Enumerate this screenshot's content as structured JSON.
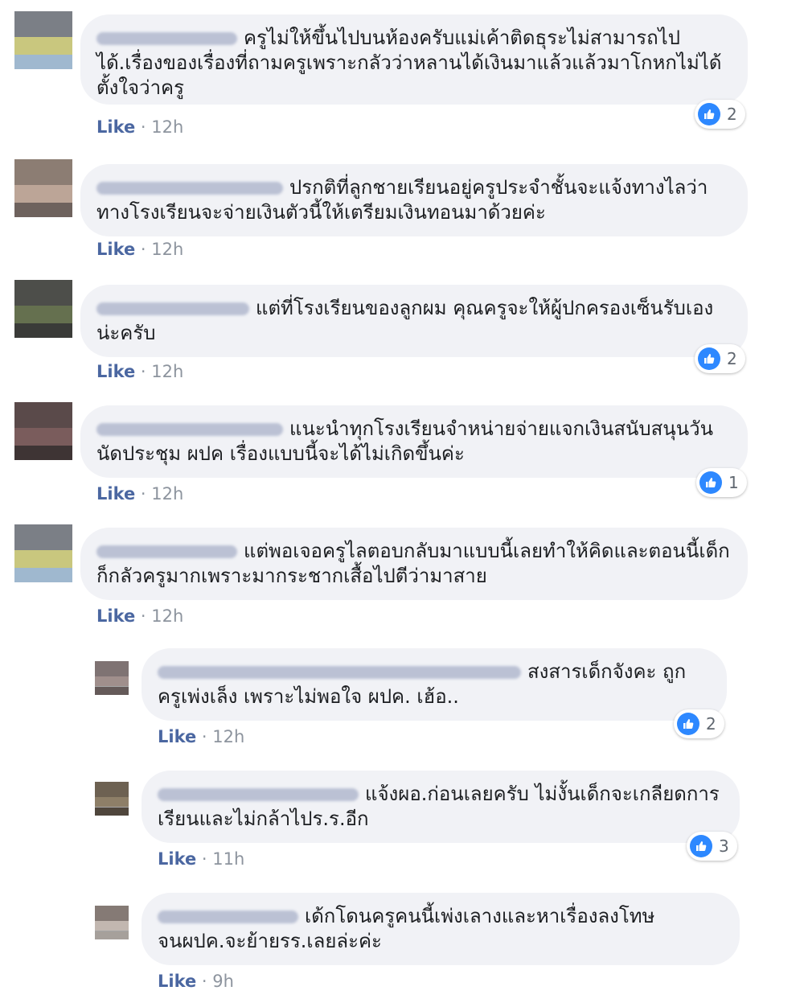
{
  "like_label": "Like",
  "comments": [
    {
      "name_width": 175,
      "text": "ครูไม่ให้ขึ้นไปบนห้องครับแม่เค้าติดธุระไม่สามารถไปได้.เรื่องของเรื่องที่ถามครูเพราะกลัวว่าหลานได้เงินมาแล้วแล้วมาโกหกไม่ได้ตั้งใจว่าครู",
      "time": "12h",
      "reactions": "2",
      "avatar_colors": [
        "#7b7f86",
        "#c9c77e",
        "#9fb8cf"
      ]
    },
    {
      "name_width": 232,
      "text": "ปรกติที่ลูกชายเรียนอยู่ครูประจำชั้นจะแจ้งทางไลว่าทางโรงเรียนจะจ่ายเงินตัวนี้ให้เตรียมเงินทอนมาด้วยค่ะ",
      "time": "12h",
      "reactions": "",
      "avatar_colors": [
        "#8c7d73",
        "#bca597",
        "#6e625d"
      ]
    },
    {
      "name_width": 190,
      "text": "แต่ที่โรงเรียนของลูกผม คุณครูจะให้ผู้ปกครองเซ็นรับเองน่ะครับ",
      "time": "12h",
      "reactions": "2",
      "avatar_colors": [
        "#4d4e4a",
        "#65704f",
        "#3a3b38"
      ]
    },
    {
      "name_width": 232,
      "text": "แนะนำทุกโรงเรียนจำหน่ายจ่ายแจกเงินสนับสนุนวันนัดประชุม ผปค เรื่องแบบนี้จะได้ไม่เกิดขึ้นค่ะ",
      "time": "12h",
      "reactions": "1",
      "avatar_colors": [
        "#5a4a4a",
        "#7a5c5c",
        "#3e3434"
      ]
    },
    {
      "name_width": 175,
      "text": "แต่พอเจอครูไลตอบกลับมาแบบนี้เลยทำให้คิดและตอนนี้เด็กก็กลัวครูมากเพราะมากระชากเสื้อไปตีว่ามาสาย",
      "time": "12h",
      "reactions": "",
      "avatar_colors": [
        "#7b7f86",
        "#c9c77e",
        "#9fb8cf"
      ]
    }
  ],
  "replies": [
    {
      "name_width": 452,
      "text": "สงสารเด็กจังคะ ถูกครูเพ่งเล็ง เพราะไม่พอใจ ผปค. เฮ้อ..",
      "time": "12h",
      "reactions": "2",
      "avatar_colors": [
        "#7f7373",
        "#a08f8c",
        "#655a59"
      ]
    },
    {
      "name_width": 250,
      "text": "แจ้งผอ.ก่อนเลยครับ ไม่งั้นเด็กจะเกลียดการเรียนและไม่กล้าไปร.ร.อีก",
      "time": "11h",
      "reactions": "3",
      "avatar_colors": [
        "#6d6152",
        "#8e7f68",
        "#4f463c"
      ]
    },
    {
      "name_width": 175,
      "text": "เด้กโดนครูคนนี้เพ่งเลางและหาเรื่องลงโทษจนผปค.จะย้ายรร.เลยล่ะค่ะ",
      "time": "9h",
      "reactions": "",
      "avatar_colors": [
        "#857a75",
        "#c2b7b0",
        "#a6a09b"
      ]
    }
  ]
}
